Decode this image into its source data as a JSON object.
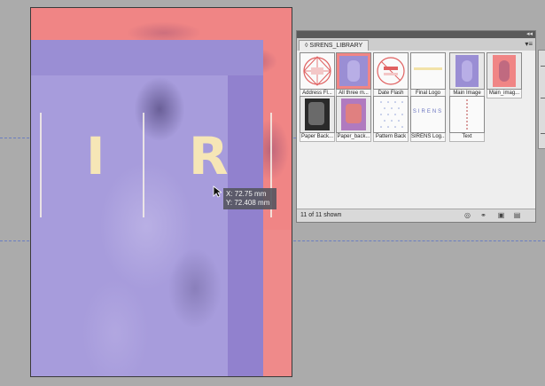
{
  "colors": {
    "canvas": "#ababab",
    "artboard_pink": "#f08585",
    "artboard_purple": "#9a8ed4",
    "letter_cream": "#f6e6b6",
    "guide": "#6a7dc0"
  },
  "artboard": {
    "letters": [
      "I",
      "R"
    ]
  },
  "tooltip": {
    "x": "X: 72.75 mm",
    "y": "Y: 72.408 mm"
  },
  "library": {
    "tab_label": "SIRENS_LIBRARY",
    "tab_icon": "library-icon",
    "menu_icon": "panel-menu-icon",
    "items": [
      {
        "label": "Address Fl..."
      },
      {
        "label": "All three m..."
      },
      {
        "label": "Date Flash"
      },
      {
        "label": "Final Logo"
      },
      {
        "label": "Main Image"
      },
      {
        "label": "Main_imag..."
      },
      {
        "label": "Paper Back..."
      },
      {
        "label": "Paper_back..."
      },
      {
        "label": "Pattern Back"
      },
      {
        "label": "SIRENS Log..."
      },
      {
        "label": "Text"
      }
    ],
    "logo_text": "SIRENS",
    "status": "11 of 11 shown",
    "footer_icons": [
      "creative-cloud-icon",
      "search-binoculars-icon",
      "new-item-icon",
      "trash-icon"
    ]
  }
}
